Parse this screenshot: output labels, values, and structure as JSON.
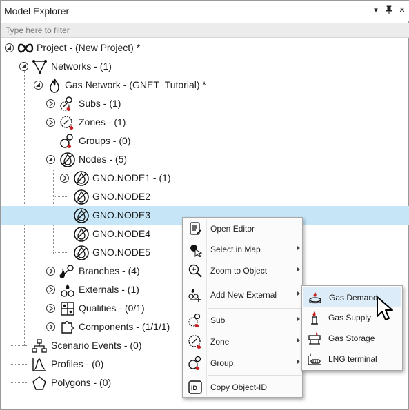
{
  "window": {
    "title": "Model Explorer",
    "pin_glyph": "▾",
    "pin2_glyph": "⯆",
    "close_glyph": "✕"
  },
  "filter": {
    "placeholder": "Type here to filter",
    "value": ""
  },
  "tree": {
    "project": "Project - (New Project) *",
    "networks": "Networks - (1)",
    "gas_network": "Gas Network - (GNET_Tutorial) *",
    "subs": "Subs - (1)",
    "zones": "Zones - (1)",
    "groups": "Groups - (0)",
    "nodes": "Nodes - (5)",
    "node1": "GNO.NODE1 - (1)",
    "node2": "GNO.NODE2",
    "node3": "GNO.NODE3",
    "node4": "GNO.NODE4",
    "node5": "GNO.NODE5",
    "branches": "Branches - (4)",
    "externals": "Externals - (1)",
    "qualities": "Qualities - (0/1)",
    "components": "Components - (1/1/1)",
    "scenario_events": "Scenario Events - (0)",
    "profiles": "Profiles - (0)",
    "polygons": "Polygons - (0)"
  },
  "context_menu": {
    "open_editor": "Open Editor",
    "select_in_map": "Select in Map",
    "zoom_to_object": "Zoom to Object",
    "add_new_external": "Add New External",
    "sub": "Sub",
    "zone": "Zone",
    "group": "Group",
    "copy_object_id": "Copy Object-ID"
  },
  "submenu": {
    "gas_demand": "Gas Demand",
    "gas_supply": "Gas Supply",
    "gas_storage": "Gas Storage",
    "lng_terminal": "LNG terminal"
  },
  "colors": {
    "selection": "#c6e6f7",
    "menu_highlight": "#dcecf8",
    "flame_red": "#c81e1e"
  }
}
